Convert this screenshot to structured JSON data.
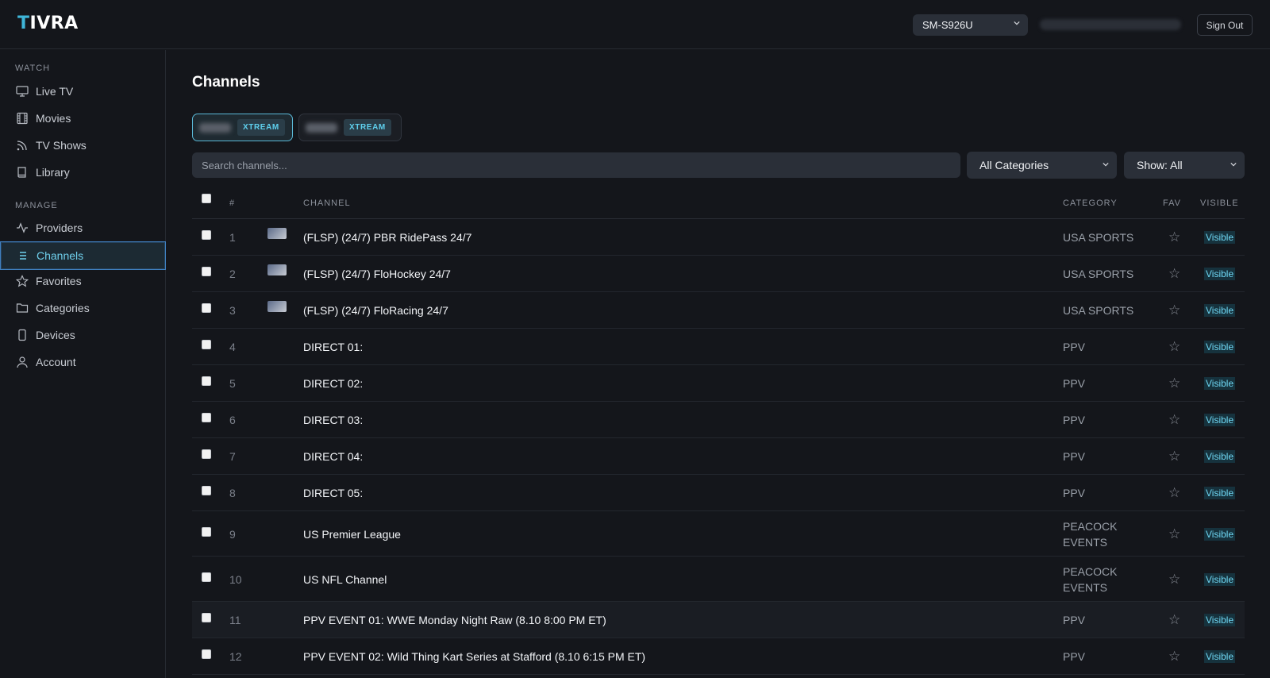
{
  "app": {
    "logo_first": "T",
    "logo_rest": "IVRA",
    "device": "SM-S926U",
    "sign_out": "Sign Out"
  },
  "sidebar": {
    "watch_label": "WATCH",
    "manage_label": "MANAGE",
    "watch_items": [
      {
        "label": "Live TV",
        "icon": "monitor-icon"
      },
      {
        "label": "Movies",
        "icon": "film-icon"
      },
      {
        "label": "TV Shows",
        "icon": "rss-icon"
      },
      {
        "label": "Library",
        "icon": "book-icon"
      }
    ],
    "manage_items": [
      {
        "label": "Providers",
        "icon": "activity-icon"
      },
      {
        "label": "Channels",
        "icon": "list-icon",
        "active": true
      },
      {
        "label": "Favorites",
        "icon": "star-icon"
      },
      {
        "label": "Categories",
        "icon": "folder-icon"
      },
      {
        "label": "Devices",
        "icon": "phone-icon"
      },
      {
        "label": "Account",
        "icon": "user-icon"
      }
    ]
  },
  "main": {
    "title": "Channels",
    "providers": [
      {
        "badge": "XTREAM",
        "active": true
      },
      {
        "badge": "XTREAM",
        "active": false
      }
    ],
    "search_placeholder": "Search channels...",
    "category_filter": "All Categories",
    "show_filter": "Show: All"
  },
  "table": {
    "headers": {
      "num": "#",
      "channel": "CHANNEL",
      "category": "CATEGORY",
      "fav": "FAV",
      "visible": "VISIBLE"
    },
    "rows": [
      {
        "num": "1",
        "channel": "(FLSP) (24/7) PBR RidePass 24/7",
        "category": "USA SPORTS",
        "thumb": true,
        "visible": "Visible"
      },
      {
        "num": "2",
        "channel": "(FLSP) (24/7) FloHockey 24/7",
        "category": "USA SPORTS",
        "thumb": true,
        "visible": "Visible"
      },
      {
        "num": "3",
        "channel": "(FLSP) (24/7) FloRacing 24/7",
        "category": "USA SPORTS",
        "thumb": true,
        "visible": "Visible"
      },
      {
        "num": "4",
        "channel": "DIRECT 01:",
        "category": "PPV",
        "thumb": false,
        "visible": "Visible"
      },
      {
        "num": "5",
        "channel": "DIRECT 02:",
        "category": "PPV",
        "thumb": false,
        "visible": "Visible"
      },
      {
        "num": "6",
        "channel": "DIRECT 03:",
        "category": "PPV",
        "thumb": false,
        "visible": "Visible"
      },
      {
        "num": "7",
        "channel": "DIRECT 04:",
        "category": "PPV",
        "thumb": false,
        "visible": "Visible"
      },
      {
        "num": "8",
        "channel": "DIRECT 05:",
        "category": "PPV",
        "thumb": false,
        "visible": "Visible"
      },
      {
        "num": "9",
        "channel": "US Premier League",
        "category": "PEACOCK EVENTS",
        "thumb": false,
        "visible": "Visible"
      },
      {
        "num": "10",
        "channel": "US NFL Channel",
        "category": "PEACOCK EVENTS",
        "thumb": false,
        "visible": "Visible"
      },
      {
        "num": "11",
        "channel": "PPV EVENT 01: WWE Monday Night Raw (8.10 8:00 PM ET)",
        "category": "PPV",
        "thumb": false,
        "visible": "Visible",
        "highlight": true
      },
      {
        "num": "12",
        "channel": "PPV EVENT 02: Wild Thing Kart Series at Stafford (8.10 6:15 PM ET)",
        "category": "PPV",
        "thumb": false,
        "visible": "Visible"
      }
    ]
  }
}
